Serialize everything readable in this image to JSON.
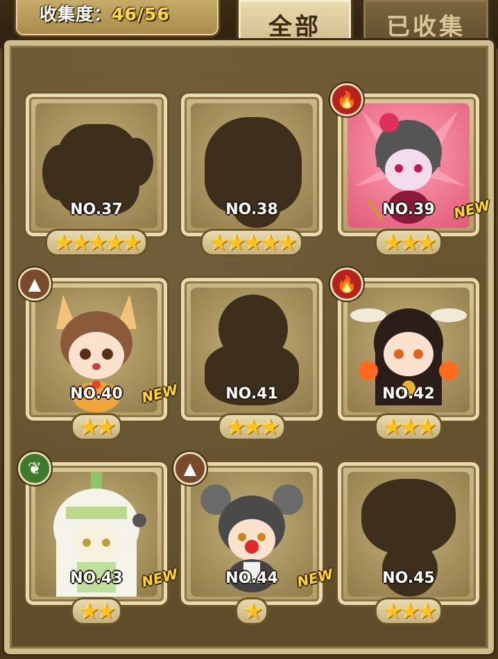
{
  "header": {
    "progress_label": "收集度：",
    "progress_value": "46/56",
    "tab_all": "全部",
    "tab_collected": "已收集"
  },
  "cards": [
    {
      "number": "NO.37",
      "stars": "★★★★★",
      "new": "",
      "state": "silhouette"
    },
    {
      "number": "NO.38",
      "stars": "★★★★★",
      "new": "",
      "state": "silhouette"
    },
    {
      "number": "NO.39",
      "stars": "★★★",
      "new": "NEW",
      "state": "collected",
      "element": "fire-icon"
    },
    {
      "number": "NO.40",
      "stars": "★★",
      "new": "NEW",
      "state": "collected",
      "element": "earth-icon"
    },
    {
      "number": "NO.41",
      "stars": "★★★",
      "new": "",
      "state": "silhouette"
    },
    {
      "number": "NO.42",
      "stars": "★★★",
      "new": "",
      "state": "collected",
      "element": "fire-icon"
    },
    {
      "number": "NO.43",
      "stars": "★★",
      "new": "NEW",
      "state": "collected",
      "element": "leaf-icon"
    },
    {
      "number": "NO.44",
      "stars": "★",
      "new": "NEW",
      "state": "collected",
      "element": "earth-icon"
    },
    {
      "number": "NO.45",
      "stars": "★★★",
      "new": "",
      "state": "silhouette"
    }
  ],
  "colors": {
    "fire": "#b3221c",
    "earth": "#7a4a2c",
    "leaf": "#3d7a2a",
    "star": "#ffc21c",
    "new_badge": "#ffd23a"
  }
}
